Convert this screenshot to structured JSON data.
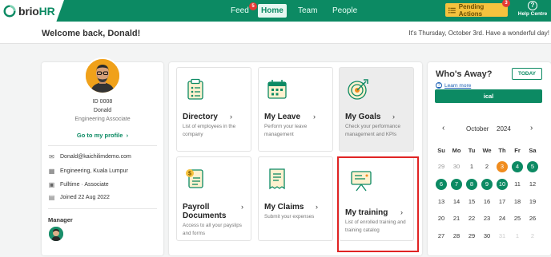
{
  "app": {
    "logo_brio": "brio",
    "logo_hr": "HR",
    "colors": {
      "primary": "#0c8a63",
      "pending": "#f6c23e",
      "badge": "#e53935",
      "highlight": "#e02424",
      "today": "#f08c1e"
    }
  },
  "nav": {
    "feed": "Feed",
    "feed_badge": "5",
    "home": "Home",
    "team": "Team",
    "people": "People",
    "pending_label": "Pending Actions",
    "pending_badge": "3",
    "help_label": "Help Centre"
  },
  "header": {
    "welcome": "Welcome back, Donald!",
    "date_text": "It's Thursday, October 3rd. Have a wonderful day!"
  },
  "profile": {
    "id": "ID 0008",
    "name": "Donald",
    "role": "Engineering Associate",
    "profile_link": "Go to my profile",
    "email": "Donald@kaichilimdemo.com",
    "location": "Engineering, Kuala Lumpur",
    "employment": "Fulltime · Associate",
    "joined": "Joined 22 Aug 2022",
    "manager_label": "Manager"
  },
  "tiles": [
    {
      "title": "Directory",
      "desc": "List of employees in the company",
      "icon": "directory-icon"
    },
    {
      "title": "My Leave",
      "desc": "Perform your leave management",
      "icon": "calendar-icon"
    },
    {
      "title": "My Goals",
      "desc": "Check your performance management and KPIs",
      "icon": "target-icon"
    },
    {
      "title": "Payroll Documents",
      "desc": "Access to all your payslips and forms",
      "icon": "payroll-icon"
    },
    {
      "title": "My Claims",
      "desc": "Submit your expenses",
      "icon": "receipt-icon"
    },
    {
      "title": "My training",
      "desc": "List of enrolled training and training catalog",
      "icon": "training-board-icon"
    }
  ],
  "away": {
    "title": "Who's Away?",
    "today_button": "TODAY",
    "learn_more": "Learn more",
    "ical_button": "ical",
    "month": "October",
    "year": "2024",
    "weekdays": [
      "Su",
      "Mo",
      "Tu",
      "We",
      "Th",
      "Fr",
      "Sa"
    ],
    "weeks": [
      [
        "29",
        "30",
        "1",
        "2",
        "3",
        "4",
        "5"
      ],
      [
        "6",
        "7",
        "8",
        "9",
        "10",
        "11",
        "12"
      ],
      [
        "13",
        "14",
        "15",
        "16",
        "17",
        "18",
        "19"
      ],
      [
        "20",
        "21",
        "22",
        "23",
        "24",
        "25",
        "26"
      ],
      [
        "27",
        "28",
        "29",
        "30",
        "31",
        "1",
        "2"
      ]
    ]
  }
}
